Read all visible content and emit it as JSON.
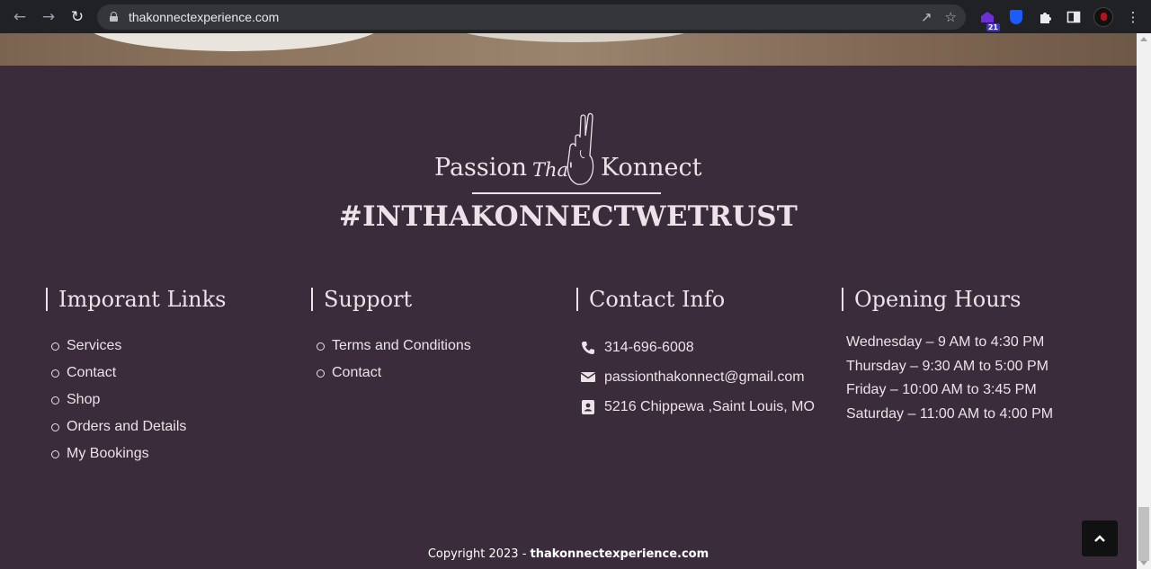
{
  "browser": {
    "url": "thakonnectexperience.com",
    "extension_badge": "21"
  },
  "brand": {
    "logo_left": "Passion",
    "logo_middle": "Tha'",
    "logo_right": "Konnect",
    "hashtag": "#INTHAKONNECTWETRUST"
  },
  "links": {
    "title": "Imporant Links",
    "items": [
      "Services",
      "Contact",
      "Shop",
      "Orders and Details",
      "My Bookings"
    ]
  },
  "support": {
    "title": "Support",
    "items": [
      "Terms and Conditions",
      "Contact"
    ]
  },
  "contact": {
    "title": "Contact Info",
    "phone": "314-696-6008",
    "email": "passionthakonnect@gmail.com",
    "address": "5216 Chippewa ,Saint Louis, MO"
  },
  "hours": {
    "title": "Opening Hours",
    "lines": [
      "Wednesday – 9 AM to 4:30 PM",
      "Thursday – 9:30 AM to 5:00 PM",
      "Friday – 10:00 AM to 3:45 PM",
      "Saturday – 11:00 AM to 4:00 PM"
    ]
  },
  "footer": {
    "copyright_prefix": "Copyright 2023 - ",
    "copyright_site": "thakonnectexperience.com"
  },
  "colors": {
    "footer_bg": "#3a2c3a",
    "text": "#ece2e8",
    "chrome_bg": "#202124"
  }
}
